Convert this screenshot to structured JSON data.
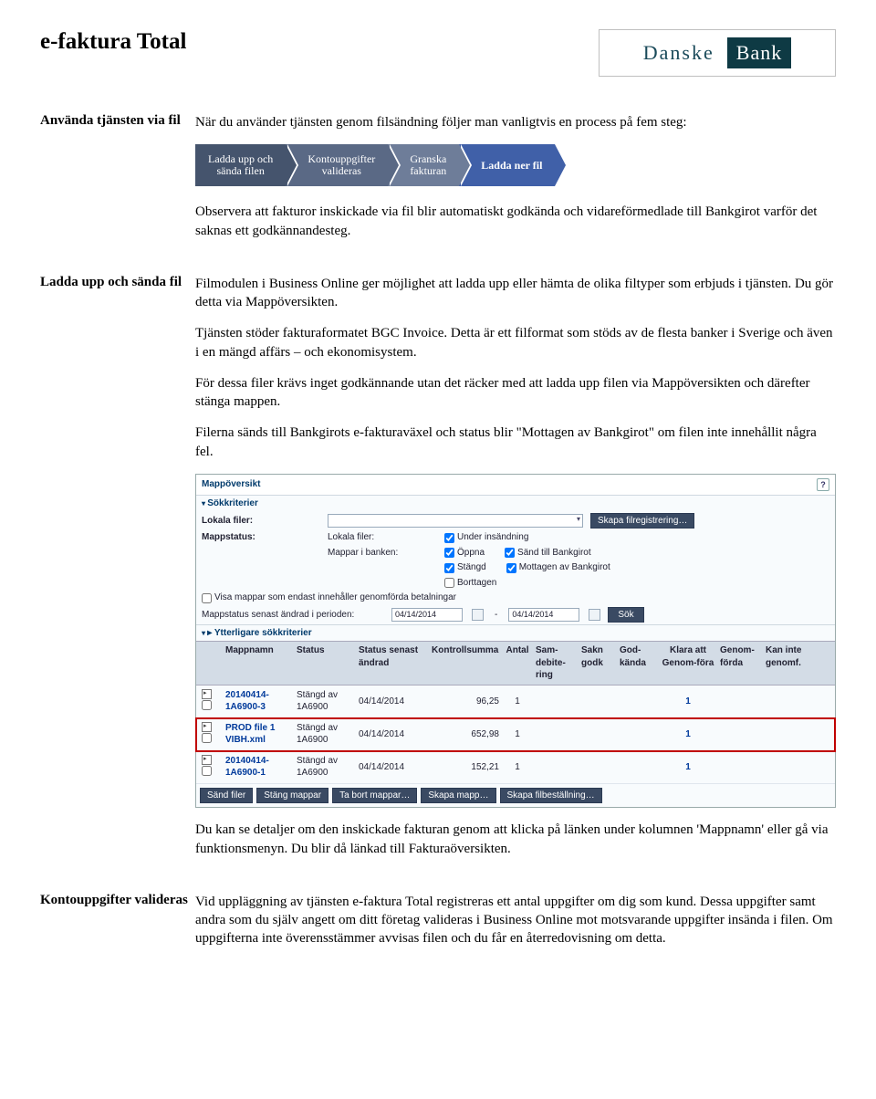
{
  "header": {
    "title": "e-faktura Total",
    "logo_brand": "Danske",
    "logo_brand2": "Bank"
  },
  "steps": {
    "s1": "Ladda upp och\nsända filen",
    "s2": "Kontouppgifter\nvalideras",
    "s3": "Granska\nfakturan",
    "s4": "Ladda ner fil"
  },
  "sec1": {
    "label": "Använda tjänsten via fil",
    "intro": "När du använder tjänsten genom filsändning följer man vanligtvis en process på fem steg:",
    "p1": "Observera att fakturor inskickade via fil blir automatiskt godkända och vidareförmedlade till Bankgirot varför det saknas ett godkännandesteg."
  },
  "sec2": {
    "label": "Ladda upp och sända fil",
    "p1": "Filmodulen i Business Online ger möjlighet att ladda upp eller hämta de olika filtyper som erbjuds i tjänsten. Du gör detta via Mappöversikten.",
    "p2": "Tjänsten stöder fakturaformatet BGC Invoice. Detta är ett filformat som stöds av de flesta banker i Sverige och även i en mängd affärs – och ekonomisystem.",
    "p3": "För dessa filer krävs inget godkännande utan det räcker med att ladda upp filen via Mappöversikten och därefter stänga mappen.",
    "p4": "Filerna sänds till Bankgirots e-fakturaväxel och status blir \"Mottagen av Bankgirot\" om filen inte innehållit några fel.",
    "after": "Du kan se detaljer om den inskickade fakturan genom att klicka på länken under kolumnen 'Mappnamn' eller gå via funktionsmenyn. Du blir då länkad till Fakturaöversikten."
  },
  "sec3": {
    "label": "Kontouppgifter valideras",
    "p1": "Vid uppläggning av tjänsten e-faktura Total registreras ett antal uppgifter om dig som kund. Dessa uppgifter samt andra som du själv angett om ditt företag valideras i Business Online mot motsvarande uppgifter insända i filen. Om uppgifterna inte överensstämmer avvisas filen och du får en återredovisning om detta."
  },
  "shot": {
    "title": "Mappöversikt",
    "help": "?",
    "crit": "Sökkriterier",
    "lokal": "Lokala filer:",
    "skapa_reg": "Skapa filregistrering…",
    "mapstatus": "Mappstatus:",
    "lokf": "Lokala filer:",
    "cb_under": "Under insändning",
    "mapp_bank": "Mappar i banken:",
    "cb_oppna": "Öppna",
    "cb_sand": "Sänd till Bankgirot",
    "cb_stangd": "Stängd",
    "cb_mott": "Mottagen av Bankgirot",
    "cb_bort": "Borttagen",
    "visa_endast": "Visa mappar som endast innehåller genomförda betalningar",
    "senast": "Mappstatus senast ändrad i perioden:",
    "d1": "04/14/2014",
    "d2": "04/14/2014",
    "sep": "-",
    "sok": "Sök",
    "ytterligare": "Ytterligare sökkriterier",
    "th_name": "Mappnamn",
    "th_stat": "Status",
    "th_date": "Status senast ändrad",
    "th_sum": "Kontrollsumma",
    "th_ant": "Antal",
    "th_sam": "Sam-debite-ring",
    "th_sakn": "Sakn godk",
    "th_god": "God-kända",
    "th_klar": "Klara att Genom-föra",
    "th_gen": "Genom-förda",
    "th_kan": "Kan inte genomf.",
    "r1_name": "20140414-1A6900-3",
    "r1_stat": "Stängd av 1A6900",
    "r1_date": "04/14/2014",
    "r1_sum": "96,25",
    "r1_ant": "1",
    "r1_klar": "1",
    "r2_name": "PROD file 1 VIBH.xml",
    "r2_stat": "Stängd av 1A6900",
    "r2_date": "04/14/2014",
    "r2_sum": "652,98",
    "r2_ant": "1",
    "r2_klar": "1",
    "r3_name": "20140414-1A6900-1",
    "r3_stat": "Stängd av 1A6900",
    "r3_date": "04/14/2014",
    "r3_sum": "152,21",
    "r3_ant": "1",
    "r3_klar": "1",
    "fb1": "Sänd filer",
    "fb2": "Stäng mappar",
    "fb3": "Ta bort mappar…",
    "fb4": "Skapa mapp…",
    "fb5": "Skapa filbeställning…"
  }
}
